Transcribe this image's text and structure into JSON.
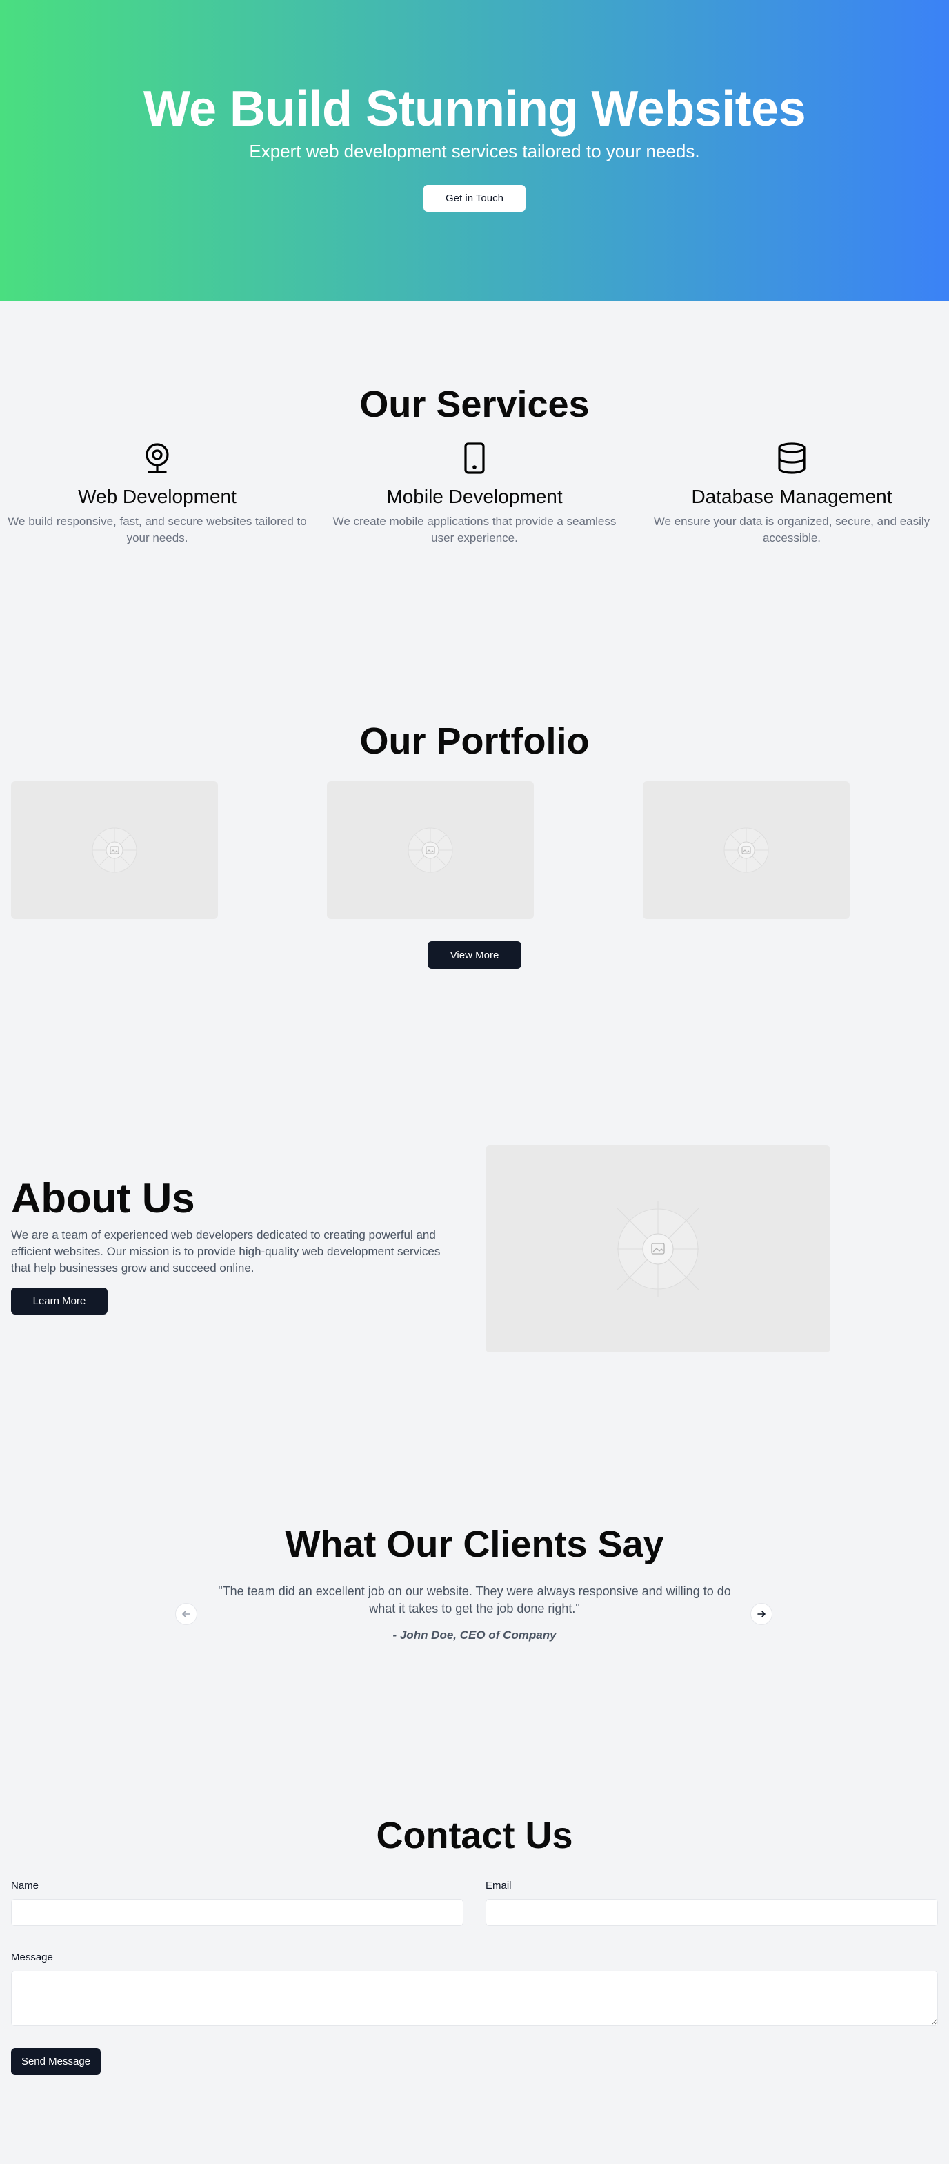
{
  "hero": {
    "title": "We Build Stunning Websites",
    "subtitle": "Expert web development services tailored to your needs.",
    "cta_label": "Get in Touch"
  },
  "services": {
    "title": "Our Services",
    "items": [
      {
        "icon": "webcam-icon",
        "title": "Web Development",
        "description": "We build responsive, fast, and secure websites tailored to your needs."
      },
      {
        "icon": "tablet-icon",
        "title": "Mobile Development",
        "description": "We create mobile applications that provide a seamless user experience."
      },
      {
        "icon": "database-icon",
        "title": "Database Management",
        "description": "We ensure your data is organized, secure, and easily accessible."
      }
    ]
  },
  "portfolio": {
    "title": "Our Portfolio",
    "view_more_label": "View More"
  },
  "about": {
    "title": "About Us",
    "text": "We are a team of experienced web developers dedicated to creating powerful and efficient websites. Our mission is to provide high-quality web development services that help businesses grow and succeed online.",
    "button_label": "Learn More"
  },
  "testimonials": {
    "title": "What Our Clients Say",
    "quote": "\"The team did an excellent job on our website. They were always responsive and willing to do what it takes to get the job done right.\"",
    "author": "- John Doe, CEO of Company"
  },
  "contact": {
    "title": "Contact Us",
    "name_label": "Name",
    "email_label": "Email",
    "message_label": "Message",
    "submit_label": "Send Message"
  },
  "colors": {
    "gradient_start": "#4ade80",
    "gradient_end": "#3b82f6",
    "dark_button": "#111827",
    "background": "#f3f4f6"
  }
}
